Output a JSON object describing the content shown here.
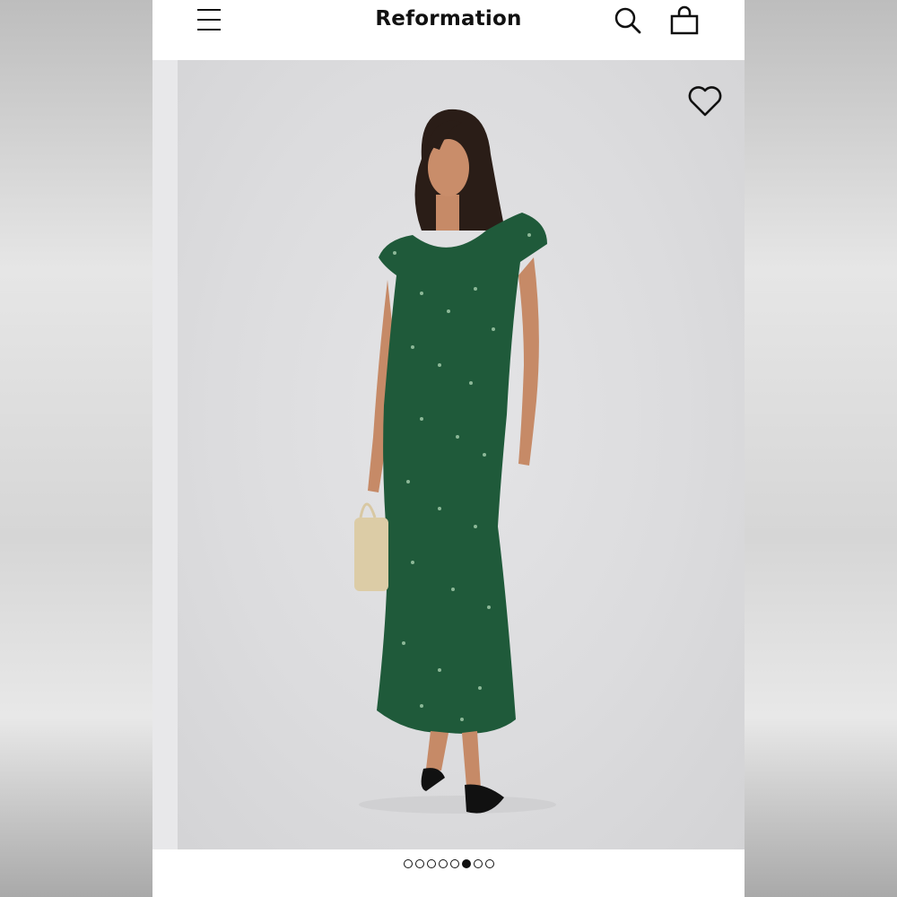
{
  "header": {
    "brand": "Reformation",
    "icons": [
      "menu-icon",
      "search-icon",
      "shopping-bag-icon"
    ]
  },
  "gallery": {
    "favorite_icon": "heart-icon",
    "slide_count": 8,
    "active_slide": 6
  },
  "colors": {
    "dress": "#1f5a3a",
    "background": "#dcdcde",
    "text": "#111111"
  }
}
